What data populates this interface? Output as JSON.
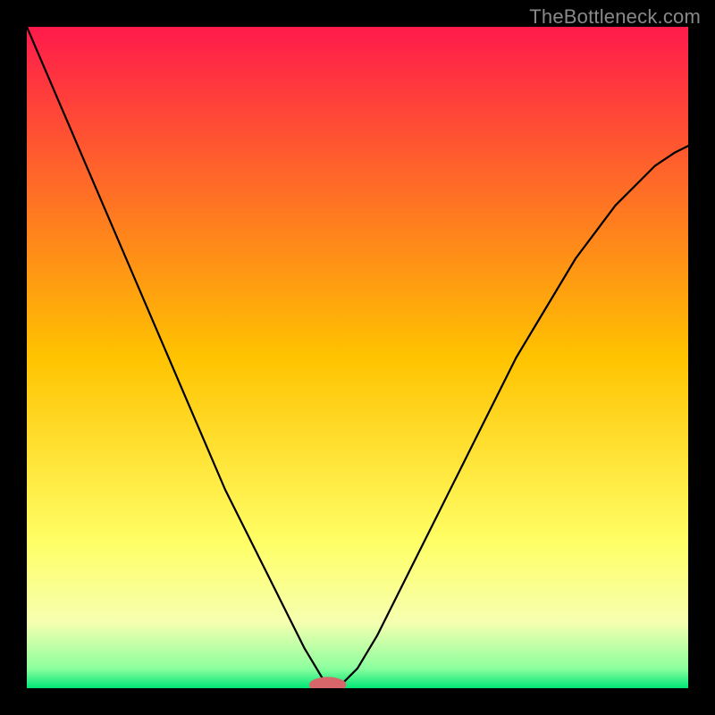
{
  "watermark": "TheBottleneck.com",
  "chart_data": {
    "type": "line",
    "title": "",
    "xlabel": "",
    "ylabel": "",
    "xlim": [
      0,
      100
    ],
    "ylim": [
      0,
      100
    ],
    "grid": false,
    "legend": false,
    "background_gradient": [
      {
        "pos": 0.0,
        "color": "#ff1a4b"
      },
      {
        "pos": 0.5,
        "color": "#ffc300"
      },
      {
        "pos": 0.78,
        "color": "#ffff66"
      },
      {
        "pos": 0.9,
        "color": "#f6ffb0"
      },
      {
        "pos": 0.97,
        "color": "#8cff9e"
      },
      {
        "pos": 1.0,
        "color": "#00e676"
      }
    ],
    "x": [
      0,
      3,
      6,
      9,
      12,
      15,
      18,
      21,
      24,
      27,
      30,
      33,
      36,
      39,
      42,
      45,
      47,
      50,
      53,
      56,
      59,
      62,
      65,
      68,
      71,
      74,
      77,
      80,
      83,
      86,
      89,
      92,
      95,
      98,
      100
    ],
    "values": [
      100,
      93,
      86,
      79,
      72,
      65,
      58,
      51,
      44,
      37,
      30,
      24,
      18,
      12,
      6,
      1,
      0,
      3,
      8,
      14,
      20,
      26,
      32,
      38,
      44,
      50,
      55,
      60,
      65,
      69,
      73,
      76,
      79,
      81,
      82
    ],
    "marker": {
      "cx": 45.5,
      "cy": 0.5,
      "rx": 2.8,
      "ry": 1.2,
      "color": "#d6666a"
    }
  }
}
